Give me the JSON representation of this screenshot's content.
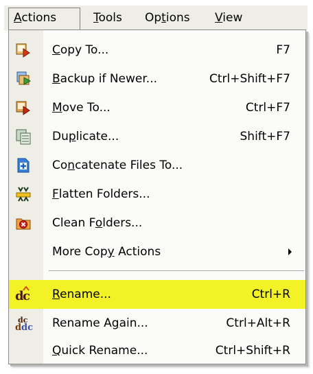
{
  "menubar": {
    "items": [
      {
        "pre": "",
        "u": "A",
        "post": "ctions"
      },
      {
        "pre": "",
        "u": "T",
        "post": "ools"
      },
      {
        "pre": "Op",
        "u": "t",
        "post": "ions"
      },
      {
        "pre": "",
        "u": "V",
        "post": "iew"
      }
    ]
  },
  "menu": {
    "items": [
      {
        "pre": "",
        "u": "C",
        "post": "opy To...",
        "shortcut": "F7",
        "icon": "copy-to-icon"
      },
      {
        "pre": "",
        "u": "B",
        "post": "ackup if Newer...",
        "shortcut": "Ctrl+Shift+F7",
        "icon": "backup-icon"
      },
      {
        "pre": "",
        "u": "M",
        "post": "ove To...",
        "shortcut": "Ctrl+F7",
        "icon": "move-to-icon"
      },
      {
        "pre": "Du",
        "u": "p",
        "post": "licate...",
        "shortcut": "Shift+F7",
        "icon": "duplicate-icon"
      },
      {
        "pre": "Co",
        "u": "n",
        "post": "catenate Files To...",
        "shortcut": "",
        "icon": "concatenate-icon"
      },
      {
        "pre": "",
        "u": "F",
        "post": "latten Folders...",
        "shortcut": "",
        "icon": "flatten-folders-icon"
      },
      {
        "pre": "Clean F",
        "u": "o",
        "post": "lders...",
        "shortcut": "",
        "icon": "clean-folders-icon"
      },
      {
        "pre": "More Cop",
        "u": "y",
        "post": " Actions",
        "shortcut": "",
        "icon": "submenu-arrow-icon"
      },
      {
        "pre": "",
        "u": "R",
        "post": "ename...",
        "shortcut": "Ctrl+R",
        "icon": "rename-icon"
      },
      {
        "pre": "Rename A",
        "u": "g",
        "post": "ain...",
        "shortcut": "Ctrl+Alt+R",
        "icon": "rename-again-icon"
      },
      {
        "pre": "",
        "u": "Q",
        "post": "uick Rename...",
        "shortcut": "Ctrl+Shift+R",
        "icon": "quick-rename-icon"
      }
    ]
  },
  "colors": {
    "highlight": "#f2f227",
    "gutter": "#eeeee6",
    "menu_bg": "#fbfbf9"
  }
}
